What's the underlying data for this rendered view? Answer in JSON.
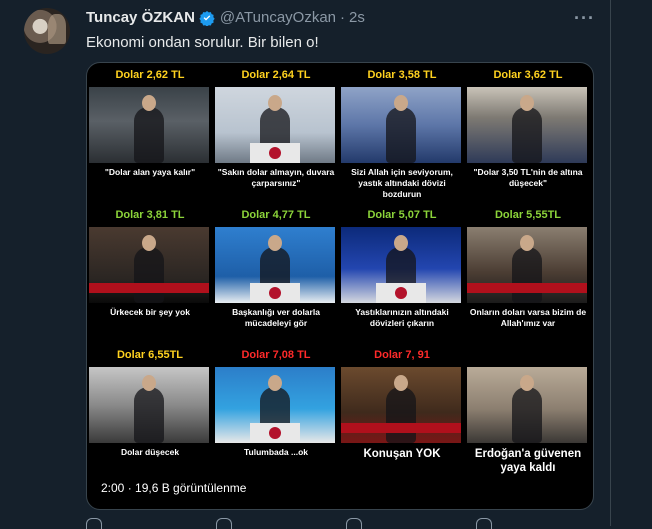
{
  "tweet": {
    "display_name": "Tuncay ÖZKAN",
    "handle": "@ATuncayOzkan",
    "separator": "·",
    "time": "2s",
    "text": "Ekonomi ondan sorulur. Bir bilen o!",
    "more_label": "···"
  },
  "media": {
    "views_text": "2:00 · 19,6 B görüntülenme",
    "cells": [
      {
        "price": "Dolar 2,62 TL",
        "price_color": "#ffd21f",
        "caption": "\"Dolar alan yaya kalır\""
      },
      {
        "price": "Dolar 2,64 TL",
        "price_color": "#ffd21f",
        "caption": "\"Sakın dolar almayın, duvara çarparsınız\""
      },
      {
        "price": "Dolar 3,58 TL",
        "price_color": "#ffd21f",
        "caption": "Sizi Allah için seviyorum, yastık altındaki dövizi bozdurun"
      },
      {
        "price": "Dolar 3,62 TL",
        "price_color": "#ffd21f",
        "caption": "\"Dolar 3,50 TL'nin de altına düşecek\""
      },
      {
        "price": "Dolar 3,81 TL",
        "price_color": "#8cd43a",
        "caption": "Ürkecek bir şey yok"
      },
      {
        "price": "Dolar 4,77 TL",
        "price_color": "#8cd43a",
        "caption": "Başkanlığı ver dolarla mücadeleyi gör"
      },
      {
        "price": "Dolar 5,07 TL",
        "price_color": "#8cd43a",
        "caption": "Yastıklarınızın altındaki dövizleri çıkarın"
      },
      {
        "price": "Dolar 5,55TL",
        "price_color": "#8cd43a",
        "caption": "Onların doları varsa bizim de Allah'ımız var"
      },
      {
        "price": "Dolar 6,55TL",
        "price_color": "#ffd21f",
        "caption": "Dolar düşecek"
      },
      {
        "price": "Dolar 7,08 TL",
        "price_color": "#ff2a2a",
        "caption": "Tulumbada ...ok"
      },
      {
        "price": "Dolar 7, 91",
        "price_color": "#ff2a2a",
        "caption": "Konuşan YOK"
      },
      {
        "price": "",
        "price_color": "#ffffff",
        "caption": "Erdoğan'a güvenen yaya kaldı"
      }
    ]
  },
  "colors": {
    "background": "#15202b",
    "secondary_text": "#8b98a5",
    "verified": "#1d9bf0"
  }
}
